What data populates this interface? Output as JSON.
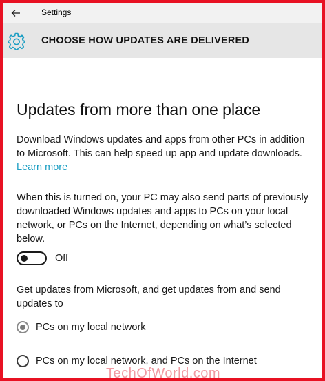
{
  "window": {
    "title": "Settings"
  },
  "header": {
    "title": "CHOOSE HOW UPDATES ARE DELIVERED"
  },
  "section": {
    "title": "Updates from more than one place",
    "paragraph1": "Download Windows updates and apps from other PCs in addition to Microsoft. This can help speed up app and update downloads.",
    "learn_more": "Learn more",
    "paragraph2": "When this is turned on, your PC may also send parts of previously downloaded Windows updates and apps to PCs on your local network, or PCs on the Internet, depending on what’s selected below.",
    "toggle_state": "Off",
    "paragraph3": "Get updates from Microsoft, and get updates from and send updates to",
    "options": [
      {
        "label": "PCs on my local network",
        "selected": true
      },
      {
        "label": "PCs on my local network, and PCs on the Internet",
        "selected": false
      }
    ]
  },
  "watermark": "TechOfWorld.com",
  "colors": {
    "border": "#e81123",
    "link": "#1b9ec3",
    "gear_icon": "#1b9ec3",
    "header_bg": "#e6e6e6"
  },
  "icons": {
    "back": "back-arrow-icon",
    "settings": "gear-icon"
  }
}
